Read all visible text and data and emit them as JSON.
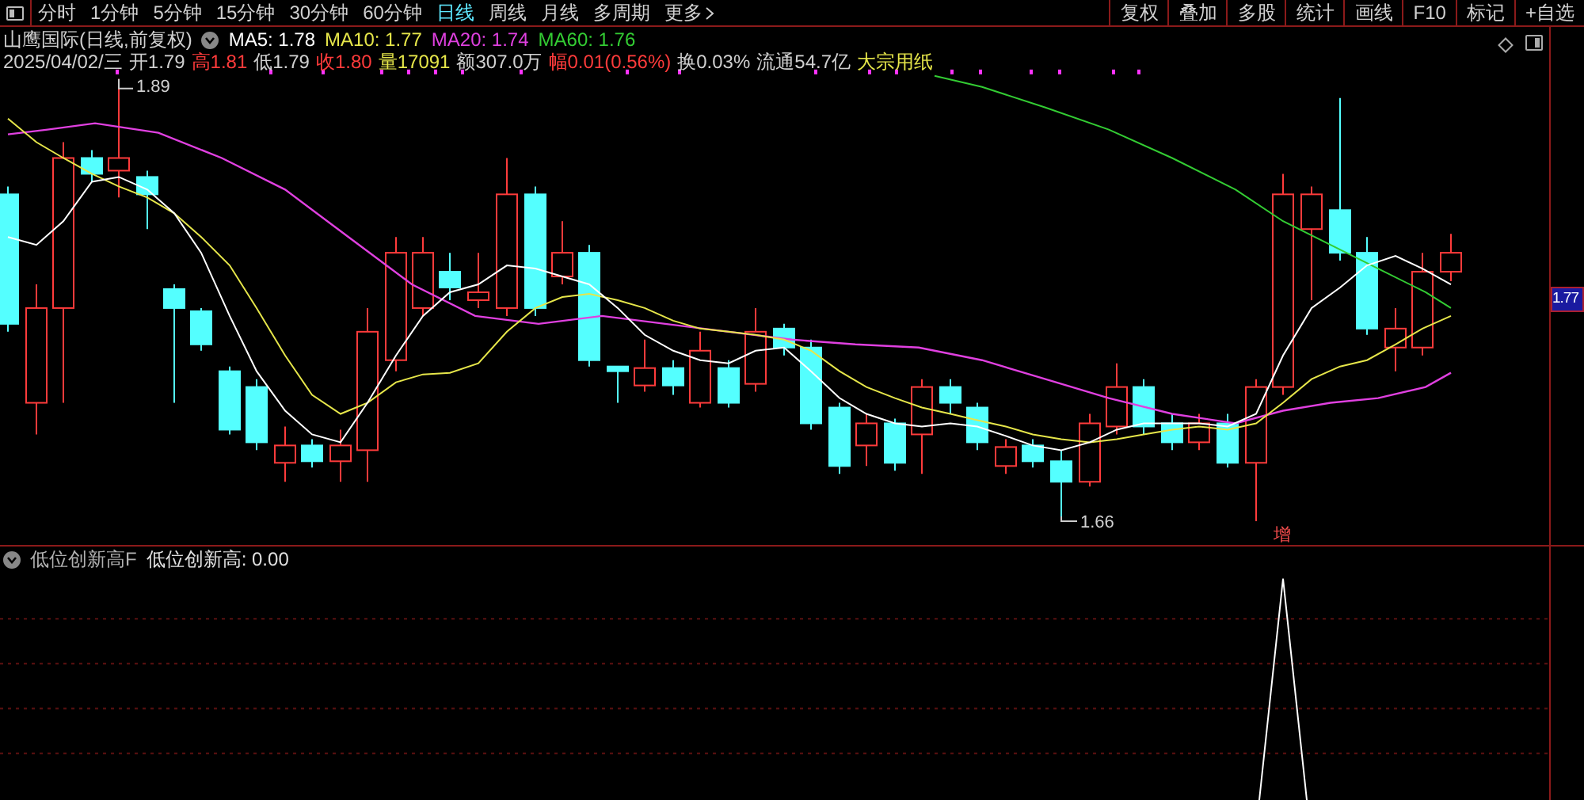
{
  "toolbar": {
    "periods": [
      {
        "label": "分时",
        "selected": false
      },
      {
        "label": "1分钟",
        "selected": false
      },
      {
        "label": "5分钟",
        "selected": false
      },
      {
        "label": "15分钟",
        "selected": false
      },
      {
        "label": "30分钟",
        "selected": false
      },
      {
        "label": "60分钟",
        "selected": false
      },
      {
        "label": "日线",
        "selected": true
      },
      {
        "label": "周线",
        "selected": false
      },
      {
        "label": "月线",
        "selected": false
      },
      {
        "label": "多周期",
        "selected": false
      },
      {
        "label": "更多",
        "selected": false
      }
    ],
    "tools": [
      "复权",
      "叠加",
      "多股",
      "统计",
      "画线",
      "F10",
      "标记",
      "+自选"
    ]
  },
  "stock": {
    "title": "山鹰国际(日线,前复权)",
    "ma": [
      {
        "label": "MA5: 1.78",
        "color": "#ffffff"
      },
      {
        "label": "MA10: 1.77",
        "color": "#e6e64a"
      },
      {
        "label": "MA20: 1.74",
        "color": "#e040e0"
      },
      {
        "label": "MA60: 1.76",
        "color": "#33cc33"
      }
    ]
  },
  "quote": {
    "date": "2025/04/02/三",
    "items": [
      {
        "label": "开",
        "value": "1.79",
        "color": "#d0d0d0"
      },
      {
        "label": "高",
        "value": "1.81",
        "color": "#ff3b3b"
      },
      {
        "label": "低",
        "value": "1.79",
        "color": "#d0d0d0"
      },
      {
        "label": "收",
        "value": "1.80",
        "color": "#ff3b3b"
      },
      {
        "label": "量",
        "value": "17091",
        "color": "#e6e64a"
      },
      {
        "label": "额",
        "value": "307.0万",
        "color": "#d0d0d0"
      },
      {
        "label": "幅",
        "value": "0.01(0.56%)",
        "color": "#ff3b3b"
      },
      {
        "label": "换",
        "value": "0.03%",
        "color": "#d0d0d0"
      },
      {
        "label": "流通",
        "value": "54.7亿",
        "color": "#d0d0d0"
      }
    ],
    "sector": "大宗用纸"
  },
  "chart": {
    "high_label": "1.89",
    "low_label": "1.66",
    "signal_label": "增",
    "axis_label": "1.77"
  },
  "indicator": {
    "name": "低位创新高F",
    "reading": "低位创新高: 0.00"
  }
}
